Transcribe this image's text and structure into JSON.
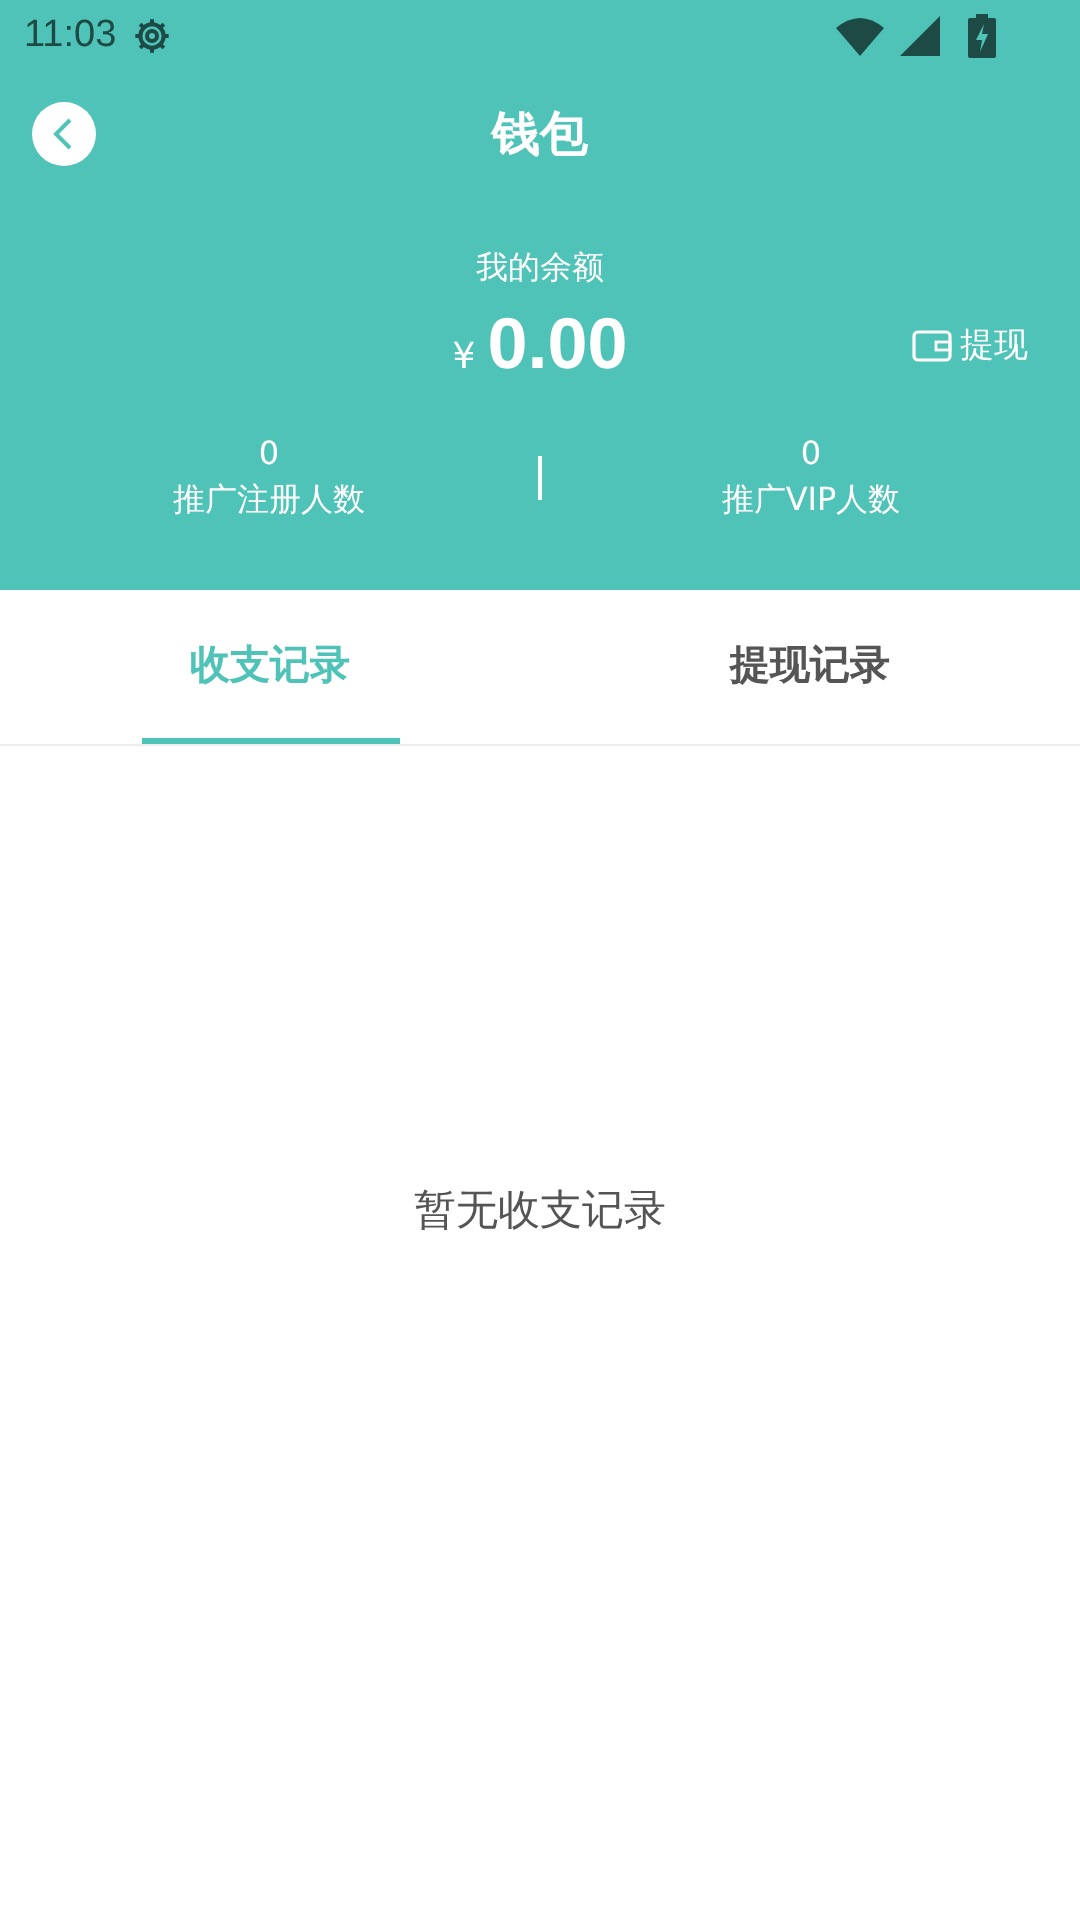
{
  "status_bar": {
    "time": "11:03"
  },
  "header": {
    "title": "钱包"
  },
  "balance": {
    "label": "我的余额",
    "currency": "¥",
    "amount": "0.00",
    "withdraw": "提现"
  },
  "stats": [
    {
      "value": "0",
      "label": "推广注册人数"
    },
    {
      "value": "0",
      "label": "推广VIP人数"
    }
  ],
  "tabs": [
    {
      "label": "收支记录",
      "selected": true
    },
    {
      "label": "提现记录",
      "selected": false
    }
  ],
  "empty_message": "暂无收支记录"
}
